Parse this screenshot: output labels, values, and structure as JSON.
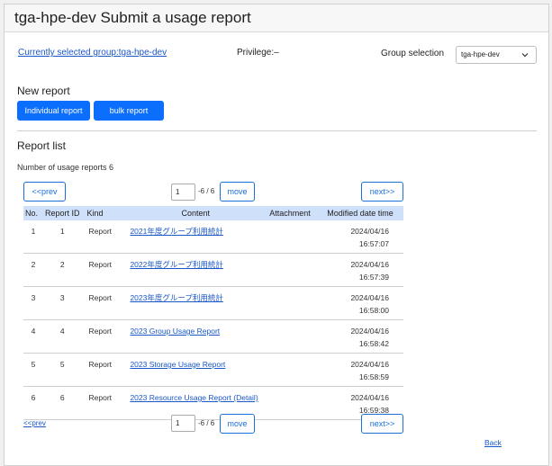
{
  "header": {
    "title": "tga-hpe-dev Submit a usage report"
  },
  "group": {
    "link_text": "Currently selected group:tga-hpe-dev",
    "privilege": "Privilege:–",
    "selection_label": "Group selection",
    "selected_value": "tga-hpe-dev"
  },
  "new_report": {
    "title": "New report",
    "individual_label": "Individual report",
    "bulk_label": "bulk report"
  },
  "report_list": {
    "title": "Report list",
    "count_text": "Number of usage reports 6",
    "pagination": {
      "prev_label": "<<prev",
      "next_label": "next>>",
      "page_value": "1",
      "range_text": "-6 / 6",
      "move_label": "move"
    },
    "columns": [
      "No.",
      "Report ID",
      "Kind",
      "Content",
      "Attachment",
      "Modified date time"
    ],
    "rows": [
      {
        "no": "1",
        "id": "1",
        "kind": "Report",
        "content": "2021年度グループ利用統計",
        "date": "2024/04/16",
        "time": "16:57:07"
      },
      {
        "no": "2",
        "id": "2",
        "kind": "Report",
        "content": "2022年度グループ利用統計",
        "date": "2024/04/16",
        "time": "16:57:39"
      },
      {
        "no": "3",
        "id": "3",
        "kind": "Report",
        "content": "2023年度グループ利用統計",
        "date": "2024/04/16",
        "time": "16:58:00"
      },
      {
        "no": "4",
        "id": "4",
        "kind": "Report",
        "content": "2023 Group Usage Report",
        "date": "2024/04/16",
        "time": "16:58:42"
      },
      {
        "no": "5",
        "id": "5",
        "kind": "Report",
        "content": "2023 Storage Usage Report",
        "date": "2024/04/16",
        "time": "16:58:59"
      },
      {
        "no": "6",
        "id": "6",
        "kind": "Report",
        "content": "2023 Resource Usage Report (Detail)",
        "date": "2024/04/16",
        "time": "16:59:38"
      }
    ]
  },
  "footer": {
    "back_label": "Back"
  }
}
